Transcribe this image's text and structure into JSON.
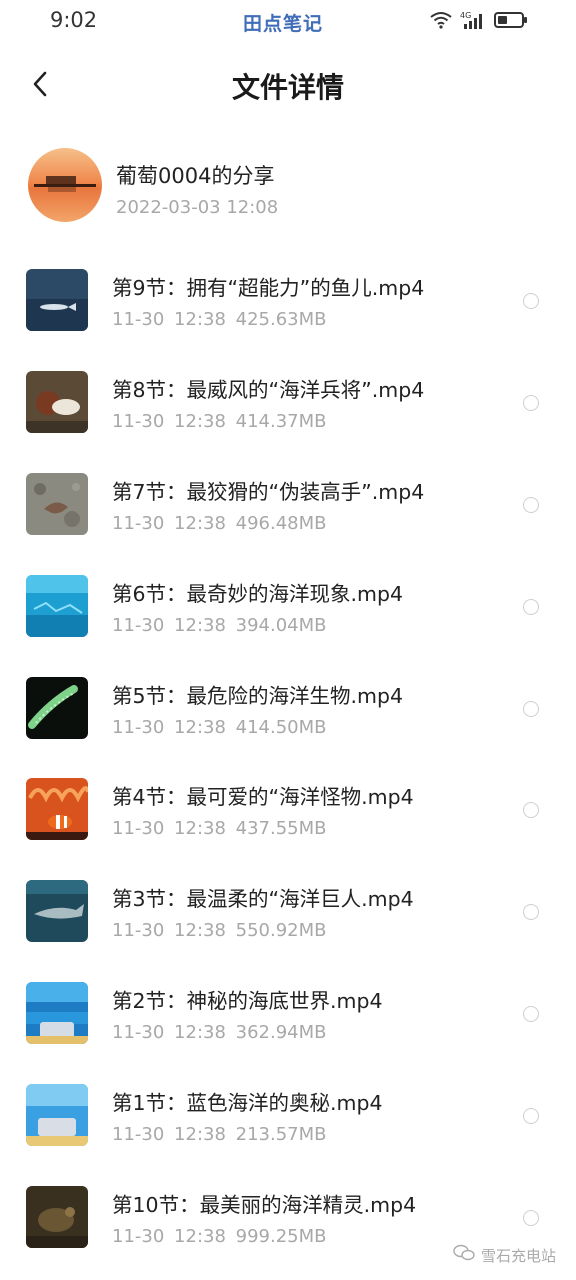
{
  "status_bar": {
    "time": "9:02",
    "app_name": "田点笔记",
    "network": "4G"
  },
  "nav": {
    "title": "文件详情"
  },
  "share": {
    "name": "葡萄0004的分享",
    "date": "2022-03-03  12:08"
  },
  "files": [
    {
      "name": "第9节：拥有“超能力”的鱼儿.mp4",
      "date": "11-30",
      "time": "12:38",
      "size": "425.63MB",
      "thumb": "fish-thumbnail"
    },
    {
      "name": "第8节：最威风的“海洋兵将”.mp4",
      "date": "11-30",
      "time": "12:38",
      "size": "414.37MB",
      "thumb": "crab-thumbnail"
    },
    {
      "name": "第7节：最狡猾的“伪装高手”.mp4",
      "date": "11-30",
      "time": "12:38",
      "size": "496.48MB",
      "thumb": "octopus-thumbnail"
    },
    {
      "name": "第6节：最奇妙的海洋现象.mp4",
      "date": "11-30",
      "time": "12:38",
      "size": "394.04MB",
      "thumb": "underwater-thumbnail"
    },
    {
      "name": "第5节：最危险的海洋生物.mp4",
      "date": "11-30",
      "time": "12:38",
      "size": "414.50MB",
      "thumb": "jellyfish-thumbnail"
    },
    {
      "name": "第4节：最可爱的“海洋怪物.mp4",
      "date": "11-30",
      "time": "12:38",
      "size": "437.55MB",
      "thumb": "clownfish-thumbnail"
    },
    {
      "name": "第3节：最温柔的“海洋巨人.mp4",
      "date": "11-30",
      "time": "12:38",
      "size": "550.92MB",
      "thumb": "whale-thumbnail"
    },
    {
      "name": "第2节：神秘的海底世界.mp4",
      "date": "11-30",
      "time": "12:38",
      "size": "362.94MB",
      "thumb": "seafloor-thumbnail"
    },
    {
      "name": "第1节：蓝色海洋的奥秘.mp4",
      "date": "11-30",
      "time": "12:38",
      "size": "213.57MB",
      "thumb": "ocean-thumbnail"
    },
    {
      "name": "第10节：最美丽的海洋精灵.mp4",
      "date": "11-30",
      "time": "12:38",
      "size": "999.25MB",
      "thumb": "reef-thumbnail"
    }
  ],
  "watermark": {
    "text": "雪石充电站"
  },
  "colors": {
    "status_app": "#3f6db8",
    "meta_text": "#a8a8a8",
    "radio_border": "#cfcfcf"
  }
}
